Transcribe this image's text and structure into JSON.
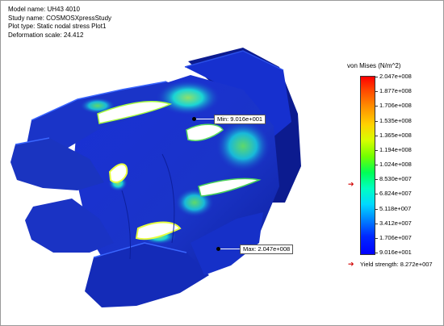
{
  "info": {
    "model_name": "Model name: UH43 4010",
    "study_name": "Study name: COSMOSXpressStudy",
    "plot_type": "Plot type: Static nodal stress Plot1",
    "deformation_scale": "Deformation scale: 24.412"
  },
  "callouts": {
    "min": "Min: 9.016e+001",
    "max": "Max: 2.047e+008"
  },
  "legend": {
    "title": "von Mises (N/m^2)",
    "ticks": [
      "2.047e+008",
      "1.877e+008",
      "1.706e+008",
      "1.535e+008",
      "1.365e+008",
      "1.194e+008",
      "1.024e+008",
      "8.530e+007",
      "6.824e+007",
      "5.118e+007",
      "3.412e+007",
      "1.706e+007",
      "9.016e+001"
    ],
    "yield_label": "Yield strength: 8.272e+007",
    "yield_marker_icon": "red-arrow-icon"
  },
  "colors": {
    "part_base": "#1b33c8",
    "part_dark": "#0a1a8a",
    "stress_cyan": "#1ad5d5",
    "stress_green": "#4ad25a",
    "stress_max": "#e6ff40",
    "yield_marker": "#d00000"
  }
}
